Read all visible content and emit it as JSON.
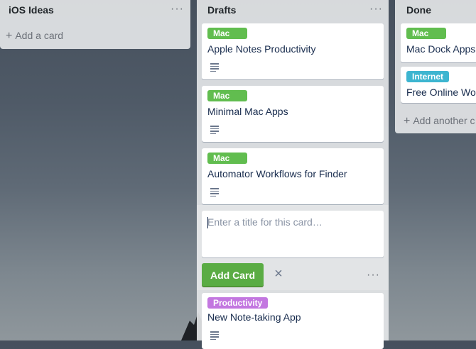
{
  "lists": [
    {
      "title": "iOS Ideas",
      "menu": "···",
      "add_card": "Add a card",
      "cards": []
    },
    {
      "title": "Drafts",
      "menu": "···",
      "cards": [
        {
          "label": "Mac",
          "label_color": "#61bd4f",
          "title": "Apple Notes Productivity",
          "has_description": true
        },
        {
          "label": "Mac",
          "label_color": "#61bd4f",
          "title": "Minimal Mac Apps",
          "has_description": true
        },
        {
          "label": "Mac",
          "label_color": "#61bd4f",
          "title": "Automator Workflows for Finder",
          "has_description": true
        },
        {
          "label": "Productivity",
          "label_color": "#c377e0",
          "title": "New Note-taking App",
          "has_description": true
        }
      ],
      "composer": {
        "placeholder": "Enter a title for this card…",
        "value": "",
        "add_button": "Add Card",
        "close_icon": "×",
        "menu": "···"
      }
    },
    {
      "title": "Done",
      "menu": "···",
      "add_card": "Add another c",
      "cards": [
        {
          "label": "Mac",
          "label_color": "#61bd4f",
          "title": "Mac Dock Apps"
        },
        {
          "label": "Internet",
          "label_color": "#3db5d0",
          "title": "Free Online Wor"
        }
      ]
    }
  ],
  "icons": {
    "plus": "+",
    "description": "description-icon"
  }
}
